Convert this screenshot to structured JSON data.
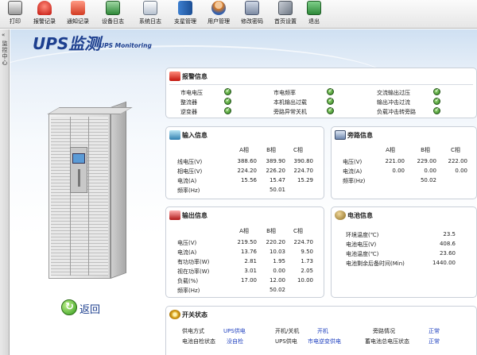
{
  "toolbar": {
    "items": [
      {
        "label": "打印",
        "icon": "printer-icon"
      },
      {
        "label": "报警记录",
        "icon": "alarm-icon"
      },
      {
        "label": "通知记录",
        "icon": "notice-icon"
      },
      {
        "label": "设备日志",
        "icon": "device-log-icon"
      },
      {
        "label": "系统日志",
        "icon": "system-log-icon"
      },
      {
        "label": "支星管理",
        "icon": "book-icon"
      },
      {
        "label": "用户管理",
        "icon": "user-icon"
      },
      {
        "label": "修改密码",
        "icon": "key-icon"
      },
      {
        "label": "首页设置",
        "icon": "tools-icon"
      },
      {
        "label": "退出",
        "icon": "exit-icon"
      }
    ]
  },
  "sidebar": {
    "label": "监控中心",
    "arrow": "«"
  },
  "page": {
    "title": "UPS监测",
    "subtitle": "UPS Monitoring",
    "back_label": "返回"
  },
  "alarm": {
    "title": "报警信息",
    "items": [
      {
        "label": "市电电压",
        "status": "ok"
      },
      {
        "label": "市电频率",
        "status": "ok"
      },
      {
        "label": "交流输出过压",
        "status": "ok"
      },
      {
        "label": "整流器",
        "status": "ok"
      },
      {
        "label": "本机输出过载",
        "status": "ok"
      },
      {
        "label": "输出冲击过流",
        "status": "ok"
      },
      {
        "label": "逆变器",
        "status": "ok"
      },
      {
        "label": "旁路异常关机",
        "status": "ok"
      },
      {
        "label": "负载冲击转旁路",
        "status": "ok"
      }
    ]
  },
  "input": {
    "title": "输入信息",
    "headers": [
      "A相",
      "B相",
      "C相"
    ],
    "rows": [
      {
        "label": "线电压(V)",
        "a": "388.60",
        "b": "389.90",
        "c": "390.80"
      },
      {
        "label": "相电压(V)",
        "a": "224.20",
        "b": "226.20",
        "c": "224.70"
      },
      {
        "label": "电流(A)",
        "a": "15.56",
        "b": "15.47",
        "c": "15.29"
      }
    ],
    "freq_label": "频率(Hz)",
    "freq_value": "50.01"
  },
  "bypass": {
    "title": "旁路信息",
    "headers": [
      "A相",
      "B相",
      "C相"
    ],
    "rows": [
      {
        "label": "电压(V)",
        "a": "221.00",
        "b": "229.00",
        "c": "222.00"
      },
      {
        "label": "电流(A)",
        "a": "0.00",
        "b": "0.00",
        "c": "0.00"
      }
    ],
    "freq_label": "频率(Hz)",
    "freq_value": "50.02"
  },
  "output": {
    "title": "输出信息",
    "headers": [
      "A相",
      "B相",
      "C相"
    ],
    "rows": [
      {
        "label": "电压(V)",
        "a": "219.50",
        "b": "220.20",
        "c": "224.70"
      },
      {
        "label": "电流(A)",
        "a": "13.76",
        "b": "10.03",
        "c": "9.50"
      },
      {
        "label": "有功功率(W)",
        "a": "2.81",
        "b": "1.95",
        "c": "1.73"
      },
      {
        "label": "视在功率(W)",
        "a": "3.01",
        "b": "0.00",
        "c": "2.05"
      },
      {
        "label": "负载(%)",
        "a": "17.00",
        "b": "12.00",
        "c": "10.00"
      }
    ],
    "freq_label": "频率(Hz)",
    "freq_value": "50.02"
  },
  "battery": {
    "title": "电池信息",
    "rows": [
      {
        "label": "环境温度(℃)",
        "value": "23.5"
      },
      {
        "label": "电池电压(V)",
        "value": "408.6"
      },
      {
        "label": "电池温度(℃)",
        "value": "23.60"
      },
      {
        "label": "电池剩余后备时间(Min)",
        "value": "1440.00"
      }
    ]
  },
  "switch": {
    "title": "开关状态",
    "rows": [
      [
        {
          "label": "供电方式",
          "value": "UPS供电"
        },
        {
          "label": "开机/关机",
          "value": "开机"
        },
        {
          "label": "旁路情况",
          "value": "正常"
        }
      ],
      [
        {
          "label": "电池自检状态",
          "value": "没自检"
        },
        {
          "label": "UPS供电",
          "value": "市电逆变供电"
        },
        {
          "label": "蓄电池总电压状态",
          "value": "正常"
        }
      ]
    ]
  },
  "colors": {
    "accent": "#1d3f8f",
    "value_blue": "#1e3fbf",
    "ok_green": "#2c7a1c"
  }
}
